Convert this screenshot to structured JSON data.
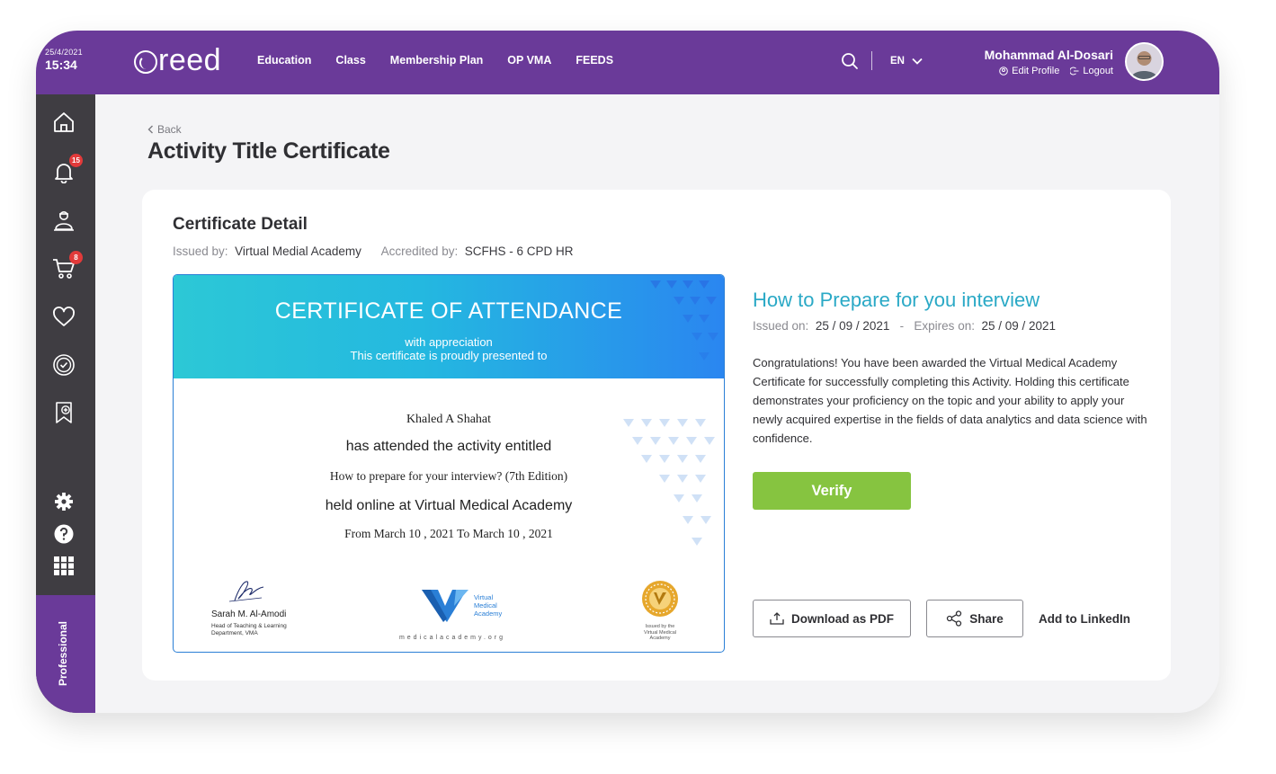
{
  "clock": {
    "date": "25/4/2021",
    "time": "15:34"
  },
  "brand": {
    "logo_text": "reed"
  },
  "nav": [
    "Education",
    "Class",
    "Membership Plan",
    "OP VMA",
    "FEEDS"
  ],
  "language": "EN",
  "user": {
    "name": "Mohammad Al-Dosari",
    "edit_profile": "Edit Profile",
    "logout": "Logout"
  },
  "sidebar": {
    "items": [
      {
        "icon": "home-icon"
      },
      {
        "icon": "bell-icon",
        "badge": "15"
      },
      {
        "icon": "instructor-icon"
      },
      {
        "icon": "cart-icon",
        "badge": "8"
      },
      {
        "icon": "heart-icon"
      },
      {
        "icon": "certificate-badge-icon"
      },
      {
        "icon": "bookmark-add-icon"
      },
      {
        "icon": "gear-icon"
      },
      {
        "icon": "help-icon"
      },
      {
        "icon": "grid-icon"
      }
    ],
    "profile_label": "Professional"
  },
  "page": {
    "back_label": "Back",
    "title": "Activity Title Certificate"
  },
  "card": {
    "title": "Certificate Detail",
    "issued_by_label": "Issued by:",
    "issued_by_value": "Virtual Medial Academy",
    "accredited_by_label": "Accredited by:",
    "accredited_by_value": "SCFHS - 6 CPD HR"
  },
  "certificate": {
    "title": "CERTIFICATE OF ATTENDANCE",
    "subtitle1": "with appreciation",
    "subtitle2": "This certificate is proudly presented to",
    "name": "Khaled A Shahat",
    "line2": "has attended the activity entitled",
    "activity": "How to prepare for your interview? (7th Edition)",
    "line4": "held online at Virtual Medical Academy",
    "dates": "From March 10 , 2021  To  March 10 , 2021",
    "signer_name": "Sarah M. Al-Amodi",
    "signer_role_line1": "Head of Teaching & Learning",
    "signer_role_line2": "Department, VMA",
    "vma_text_line1": "Virtual",
    "vma_text_line2": "Medical",
    "vma_text_line3": "Academy",
    "vma_url": "medicalacademy.org",
    "seal_text_line1": "Issued by the",
    "seal_text_line2": "Virtual Medical Academy"
  },
  "details": {
    "course_title": "How to Prepare for you interview",
    "issued_on_label": "Issued on:",
    "issued_on_value": "25 / 09 / 2021",
    "separator": "-",
    "expires_on_label": "Expires on:",
    "expires_on_value": "25 / 09 / 2021",
    "description": "Congratulations! You have been awarded the Virtual Medical Academy Certificate for successfully completing this Activity. Holding this certificate demonstrates your proficiency on the topic and your ability to apply your newly acquired expertise in the fields of data analytics and data science with confidence.",
    "verify_label": "Verify",
    "download_label": "Download as PDF",
    "share_label": "Share",
    "linkedin_label": "Add to LinkedIn"
  },
  "colors": {
    "brand_purple": "#6a3a99",
    "sidebar_dark": "#3f3d42",
    "accent_teal": "#2aa9c6",
    "verify_green": "#86c440",
    "badge_red": "#e23a3a"
  }
}
